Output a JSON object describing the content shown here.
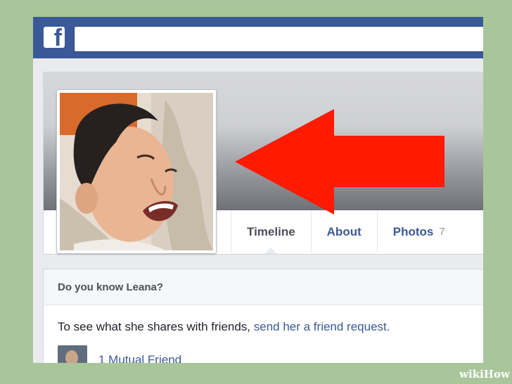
{
  "header": {
    "logo_letter": "f",
    "search": {
      "value": "",
      "placeholder": ""
    }
  },
  "profile": {
    "tabs": [
      {
        "label": "Timeline",
        "count": ""
      },
      {
        "label": "About",
        "count": ""
      },
      {
        "label": "Photos",
        "count": "7"
      }
    ]
  },
  "friend_prompt": {
    "title": "Do you know Leana?",
    "text": "To see what she shares with friends, ",
    "link": "send her a friend request.",
    "mutual_label": "1 Mutual Friend"
  },
  "annotation": {
    "arrow_color": "#ff1a00"
  },
  "watermark": {
    "wiki": "wiki",
    "how": "How"
  },
  "colors": {
    "brand": "#3b5998",
    "background": "#a9c69a"
  }
}
